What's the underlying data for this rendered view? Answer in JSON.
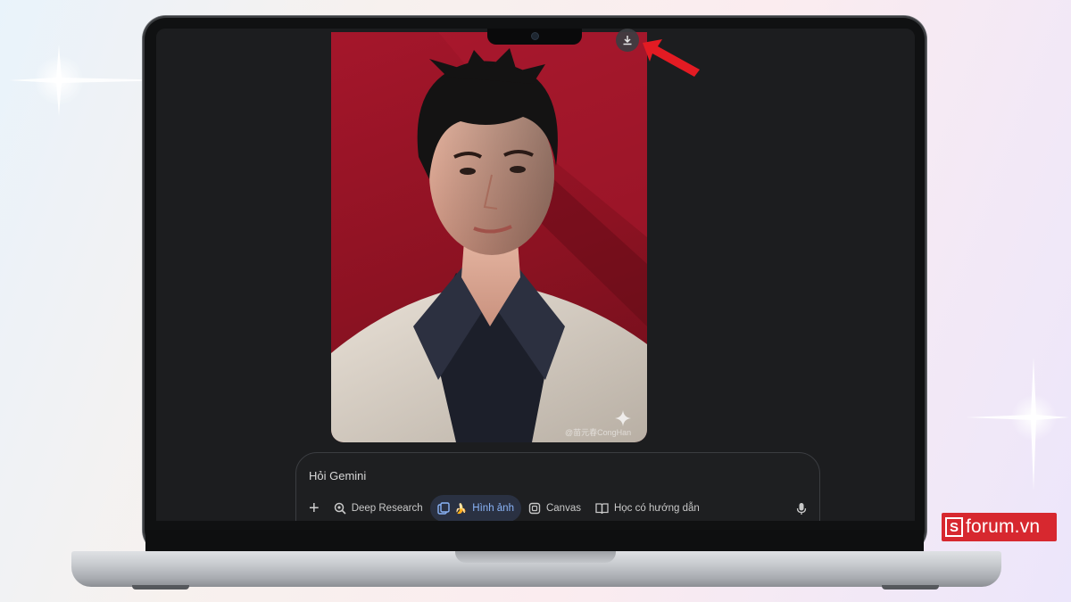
{
  "prompt": {
    "placeholder": "Hỏi Gemini",
    "add_icon": "plus-icon"
  },
  "tools": [
    {
      "label": "Deep Research",
      "icon": "deep-research-icon",
      "active": false
    },
    {
      "label": "Hình ảnh",
      "icon": "image-icon",
      "emoji": "🍌",
      "active": true
    },
    {
      "label": "Canvas",
      "icon": "canvas-icon",
      "active": false
    },
    {
      "label": "Học có hướng dẫn",
      "icon": "guided-learning-icon",
      "active": false
    }
  ],
  "image": {
    "watermark": "@苗元春CongHan",
    "download_icon": "download-icon"
  },
  "brand": {
    "box_letter": "S",
    "text": "forum.vn"
  },
  "colors": {
    "annotation_arrow": "#e31b23",
    "active_tool": "#8ab4f8",
    "brand": "#d7282f"
  }
}
